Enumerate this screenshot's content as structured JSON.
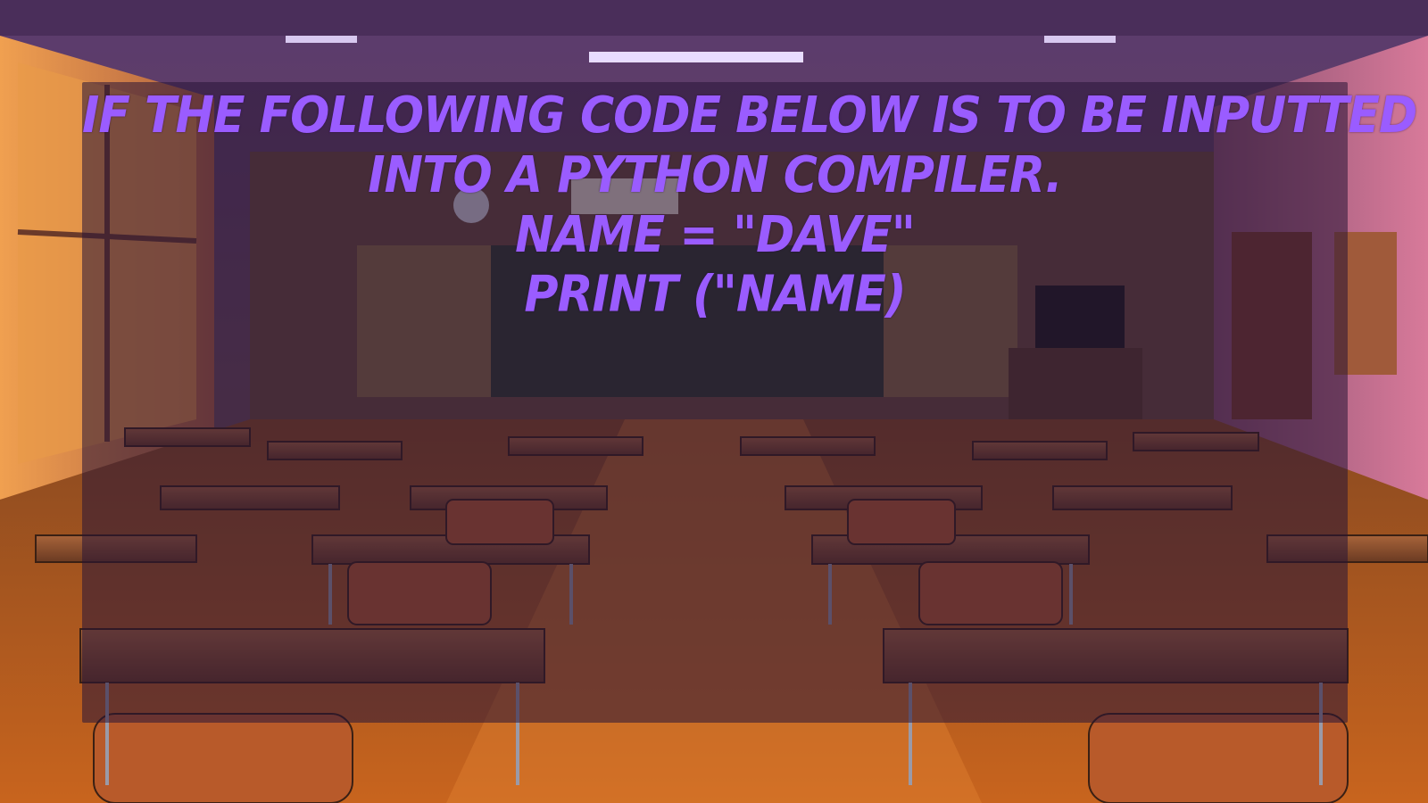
{
  "slide": {
    "background": "classroom-scene",
    "text_color": "#9a5cff",
    "overlay_color": "#281437",
    "lines": [
      "IF THE FOLLOWING CODE BELOW IS TO BE INPUTTED",
      "INTO A PYTHON COMPILER.",
      "NAME = \"DAVE\"",
      "PRINT (\"NAME)"
    ]
  }
}
